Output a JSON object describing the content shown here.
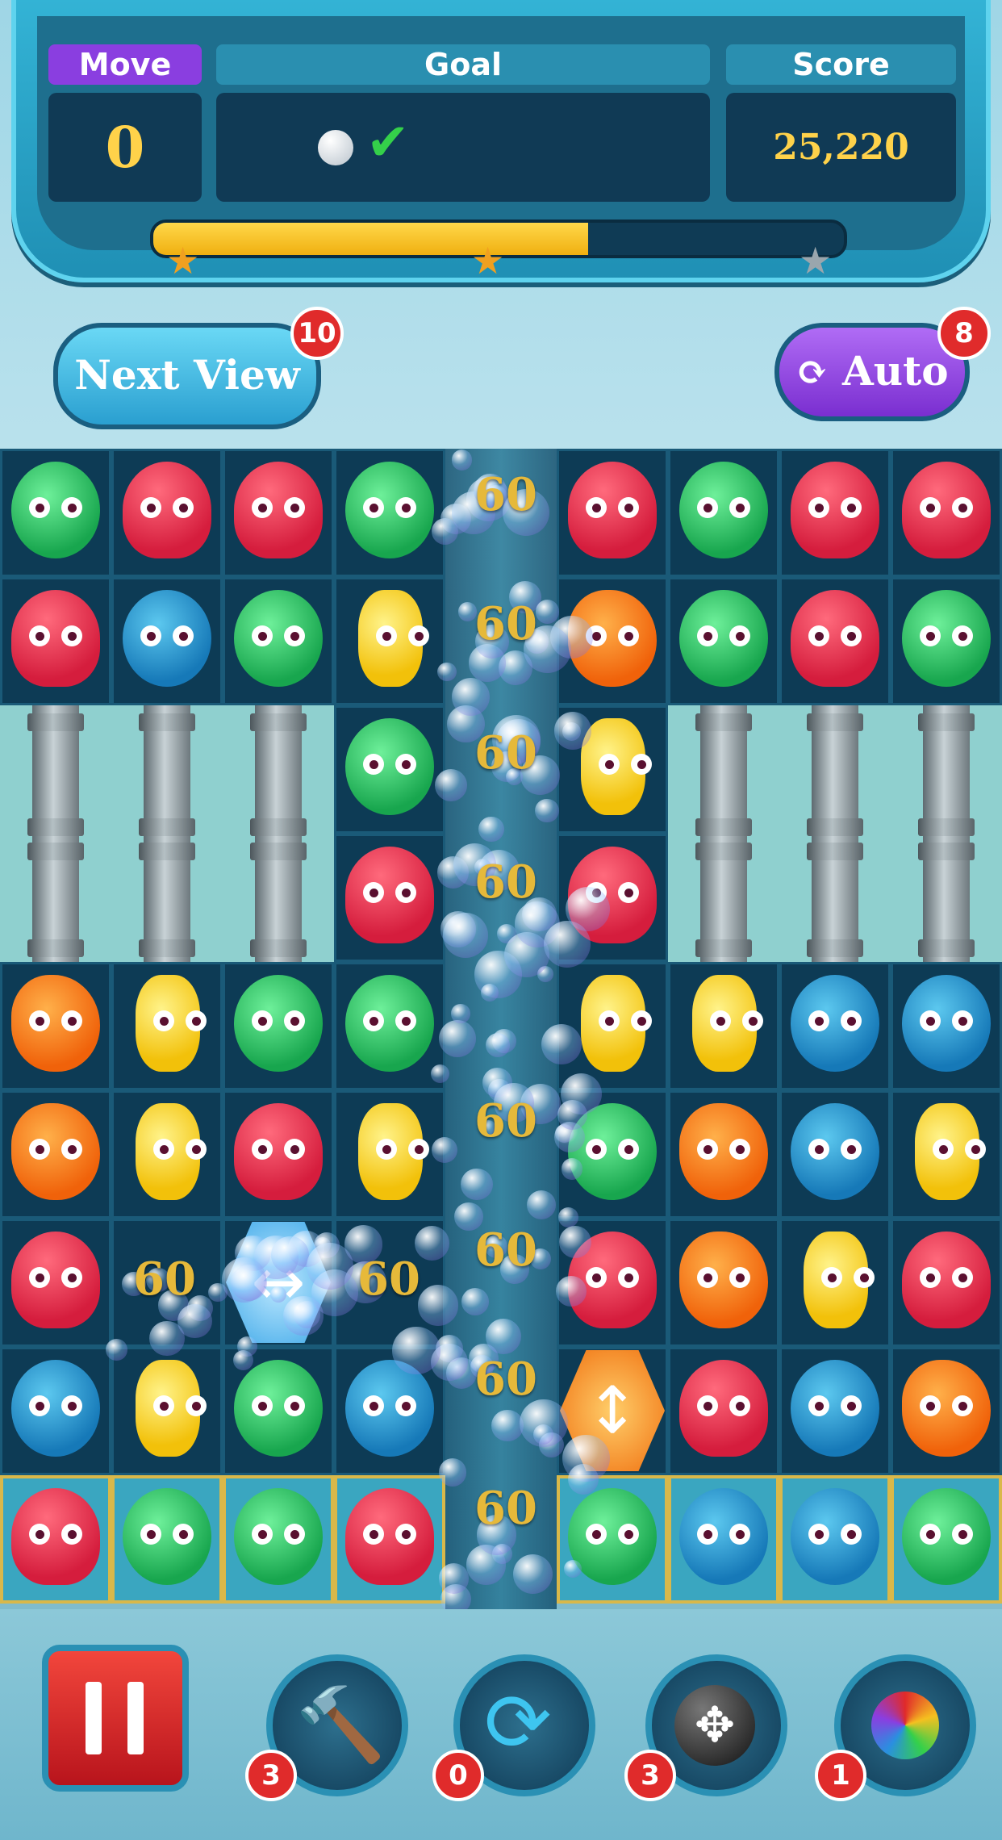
{
  "hud": {
    "move_label": "Move",
    "goal_label": "Goal",
    "score_label": "Score",
    "move_value": "0",
    "score_value": "25,220",
    "progress_fraction": 0.63
  },
  "buttons": {
    "next_view_label": "Next View",
    "next_view_badge": "10",
    "auto_label": "Auto",
    "auto_badge": "8"
  },
  "points": [
    "60",
    "60",
    "60",
    "60",
    "60",
    "60",
    "60",
    "60",
    "60",
    "60"
  ],
  "tools": {
    "hammer_count": "3",
    "shuffle_count": "0",
    "bomb_count": "3",
    "potion_count": "1"
  },
  "colors": {
    "accent": "#2aa8d0",
    "progress": "#f2c018",
    "auto_button": "#8a3ee0",
    "next_button": "#3fc3e8"
  }
}
